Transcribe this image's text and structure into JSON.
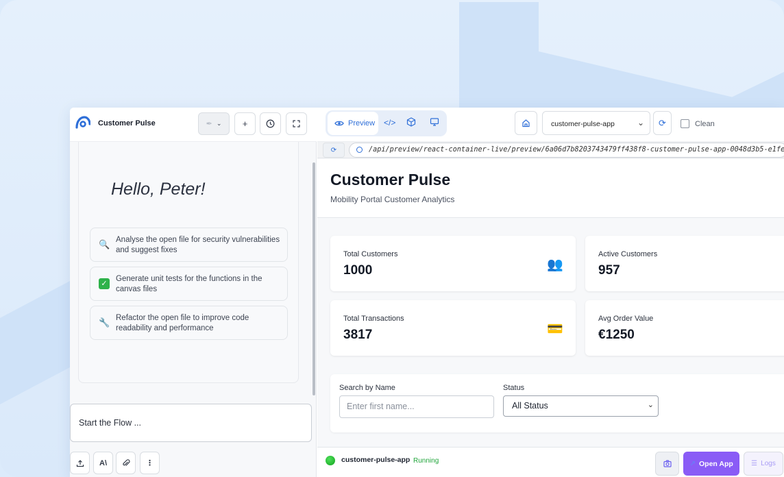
{
  "sidebar": {
    "title": "Customer Pulse",
    "greeting": "Hello, Peter!",
    "suggestions": [
      {
        "icon": "magnifier-icon",
        "text": "Analyse the open file for security vulnerabilities and suggest fixes"
      },
      {
        "icon": "checkmark-icon",
        "text": "Generate unit tests for the functions in the canvas files"
      },
      {
        "icon": "wrench-icon",
        "text": "Refactor the open file to improve code readability and performance"
      }
    ],
    "composer_placeholder": "Start the Flow ...",
    "footer_model_label": "A\\"
  },
  "preview": {
    "tab_label": "Preview",
    "app_select_value": "customer-pulse-app",
    "clean_label": "Clean",
    "url": "/api/preview/react-container-live/preview/6a06d7b8203743479ff438f8-customer-pulse-app-0048d3b5-e1fe"
  },
  "page": {
    "title": "Customer Pulse",
    "subtitle": "Mobility Portal Customer Analytics",
    "stats": [
      {
        "label": "Total Customers",
        "value": "1000",
        "icon": "people-icon"
      },
      {
        "label": "Active Customers",
        "value": "957",
        "icon": ""
      },
      {
        "label": "Total Transactions",
        "value": "3817",
        "icon": "credit-card-icon"
      },
      {
        "label": "Avg Order Value",
        "value": "€1250",
        "icon": ""
      }
    ],
    "filters": {
      "search_label": "Search by Name",
      "search_placeholder": "Enter first name...",
      "status_label": "Status",
      "status_value": "All Status"
    }
  },
  "footer": {
    "app_name": "customer-pulse-app",
    "status": "Running",
    "open_label": "Open App",
    "logs_label": "Logs"
  },
  "colors": {
    "accent": "#2f6fd8",
    "primary_button": "#8a5cf6",
    "running": "#1fa43a"
  }
}
